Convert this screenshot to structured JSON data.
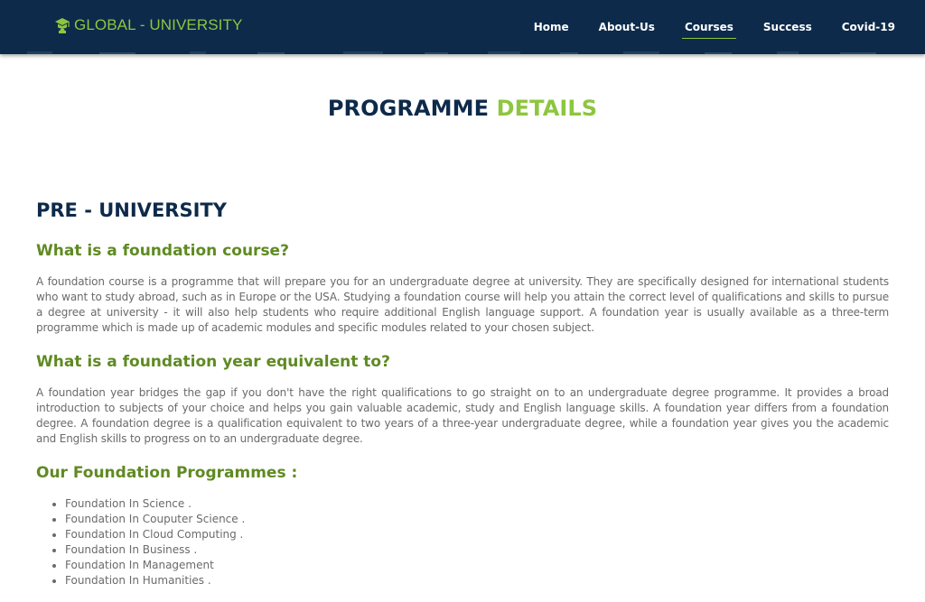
{
  "nav": {
    "brand": "GLOBAL - UNIVERSITY",
    "brand_icon": "graduation-cap-icon",
    "links": [
      {
        "label": "Home"
      },
      {
        "label": "About-Us"
      },
      {
        "label": "Courses",
        "active": true
      },
      {
        "label": "Success"
      },
      {
        "label": "Covid-19"
      }
    ]
  },
  "page_title": {
    "part1": "PROGRAMME",
    "part2": "DETAILS"
  },
  "section_title": "PRE - UNIVERSITY",
  "q1": {
    "heading": "What is a foundation course?",
    "text": "A foundation course is a programme that will prepare you for an undergraduate degree at university. They are specifically designed for international students who want to study abroad, such as in Europe or the USA. Studying a foundation course will help you attain the correct level of qualifications and skills to pursue a degree at university - it will also help students who require additional English language support. A foundation year is usually available as a three-term programme which is made up of academic modules and specific modules related to your chosen subject."
  },
  "q2": {
    "heading": "What is a foundation year equivalent to?",
    "text": "A foundation year bridges the gap if you don't have the right qualifications to go straight on to an undergraduate degree programme. It provides a broad introduction to subjects of your choice and helps you gain valuable academic, study and English language skills. A foundation year differs from a foundation degree. A foundation degree is a qualification equivalent to two years of a three-year undergraduate degree, while a foundation year gives you the academic and English skills to progress on to an undergraduate degree."
  },
  "programmes": {
    "heading": "Our Foundation Programmes :",
    "items": [
      "Foundation In Science .",
      "Foundation In Couputer Science .",
      "Foundation In Cloud Computing .",
      "Foundation In Business .",
      "Foundation In Management",
      "Foundation In Humanities ."
    ]
  },
  "colors": {
    "navy": "#0d2a4a",
    "green": "#8dc63f",
    "dark_green": "#5f8a22"
  }
}
